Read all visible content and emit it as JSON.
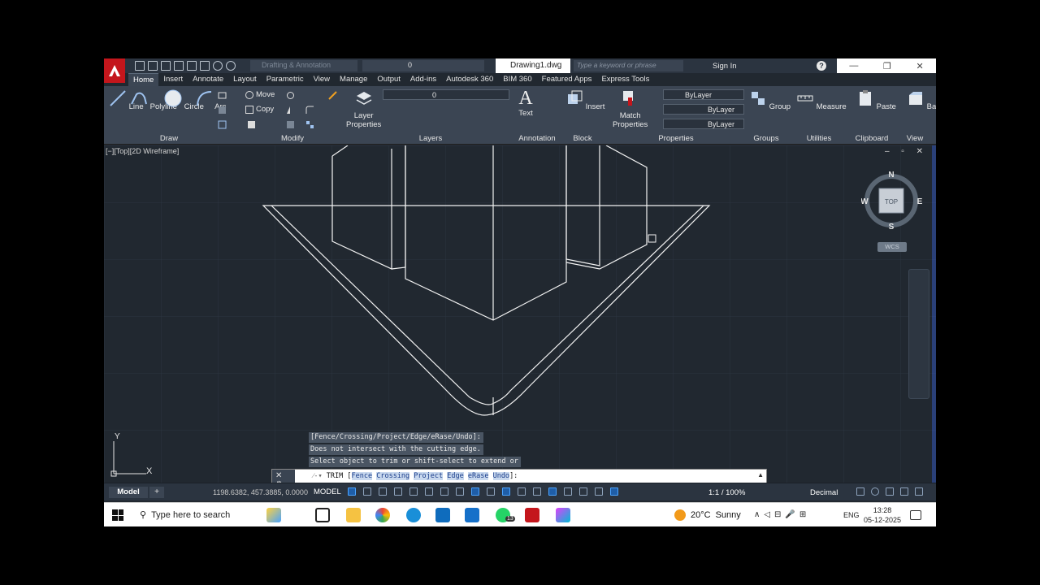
{
  "window": {
    "document_title": "Drawing1.dwg",
    "workspace": "Drafting & Annotation",
    "qat_layer": "0",
    "search_placeholder": "Type a keyword or phrase",
    "sign_in": "Sign In",
    "help": "?",
    "min": "—",
    "restore": "❐",
    "close": "✕"
  },
  "tabs": [
    "Home",
    "Insert",
    "Annotate",
    "Layout",
    "Parametric",
    "View",
    "Manage",
    "Output",
    "Add-ins",
    "Autodesk 360",
    "BIM 360",
    "Featured Apps",
    "Express Tools"
  ],
  "ribbon": {
    "draw": {
      "line": "Line",
      "polyline": "Polyline",
      "circle": "Circle",
      "arc": "Arc",
      "title": "Draw"
    },
    "modify": {
      "move": "Move",
      "copy": "Copy",
      "title": "Modify"
    },
    "layers": {
      "layer_properties_1": "Layer",
      "layer_properties_2": "Properties",
      "current_layer": "0",
      "title": "Layers"
    },
    "annotation": {
      "text": "Text",
      "title": "Annotation"
    },
    "block": {
      "insert": "Insert",
      "title": "Block"
    },
    "properties": {
      "match_1": "Match",
      "match_2": "Properties",
      "color": "ByLayer",
      "linetype": "ByLayer",
      "lineweight": "ByLayer",
      "title": "Properties"
    },
    "groups": {
      "group": "Group",
      "title": "Groups"
    },
    "utilities": {
      "measure": "Measure",
      "title": "Utilities"
    },
    "clipboard": {
      "paste": "Paste",
      "title": "Clipboard"
    },
    "view": {
      "base": "Base",
      "title": "View"
    }
  },
  "viewport": {
    "label": "[−][Top][2D Wireframe]",
    "controls": "– ▫ ✕",
    "compass": {
      "n": "N",
      "s": "S",
      "e": "E",
      "w": "W",
      "top": "TOP"
    },
    "wcs": "WCS",
    "ucs_x": "X",
    "ucs_y": "Y"
  },
  "command": {
    "history": [
      "[Fence/Crossing/Project/Edge/eRase/Undo]:",
      "Does not intersect with the cutting edge.",
      "Select object to trim or shift-select to extend or"
    ],
    "prompt_prefix": "TRIM [",
    "keywords": [
      "Fence",
      "Crossing",
      "Project",
      "Edge",
      "eRase",
      "Undo"
    ],
    "prompt_suffix": "]:"
  },
  "statusbar": {
    "model_tab": "Model",
    "add_tab": "+",
    "coordinates": "1198.6382, 457.3885, 0.0000",
    "space": "MODEL",
    "scale": "1:1 / 100%",
    "units": "Decimal"
  },
  "taskbar": {
    "search": "Type here to search",
    "weather_temp": "20°C",
    "weather_desc": "Sunny",
    "lang": "ENG",
    "time": "13:28",
    "date": "05-12-2025",
    "whatsapp_badge": "13"
  },
  "colors": {
    "autocad_red": "#c4161c",
    "ribbon_bg": "#3b4553",
    "canvas_bg": "#212830",
    "linework": "#ffffff"
  }
}
